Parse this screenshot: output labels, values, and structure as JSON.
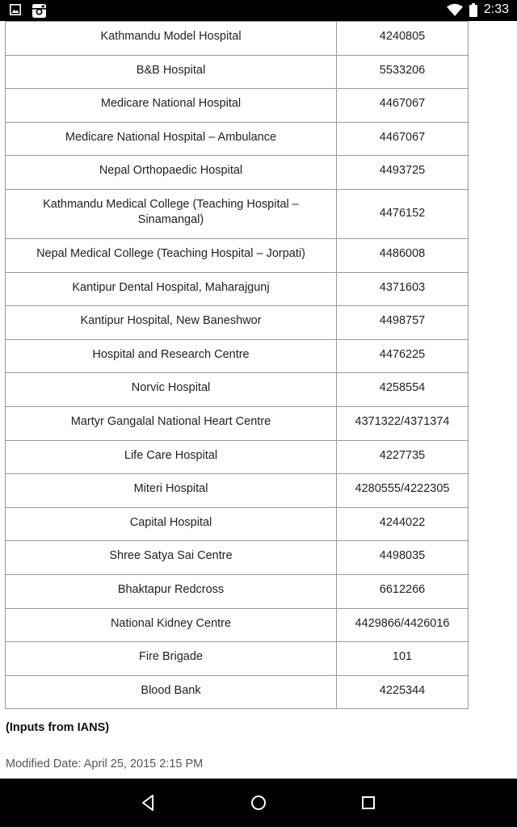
{
  "status_bar": {
    "time": "2:33",
    "left_icons": [
      "image-icon",
      "instagram-icon"
    ],
    "right_icons": [
      "wifi-icon",
      "battery-icon"
    ]
  },
  "table": {
    "rows": [
      {
        "name": "",
        "phone": ""
      },
      {
        "name": "Kathmandu Model Hospital",
        "phone": "4240805"
      },
      {
        "name": "B&B Hospital",
        "phone": "5533206"
      },
      {
        "name": "Medicare National Hospital",
        "phone": "4467067"
      },
      {
        "name": "Medicare National Hospital – Ambulance",
        "phone": "4467067"
      },
      {
        "name": "Nepal Orthopaedic Hospital",
        "phone": "4493725"
      },
      {
        "name": "Kathmandu Medical College (Teaching Hospital – Sinamangal)",
        "phone": "4476152"
      },
      {
        "name": "Nepal Medical College (Teaching Hospital – Jorpati)",
        "phone": "4486008"
      },
      {
        "name": "Kantipur Dental Hospital, Maharajgunj",
        "phone": "4371603"
      },
      {
        "name": "Kantipur Hospital, New Baneshwor",
        "phone": "4498757"
      },
      {
        "name": "Hospital and Research Centre",
        "phone": "4476225"
      },
      {
        "name": "Norvic Hospital",
        "phone": "4258554"
      },
      {
        "name": "Martyr Gangalal National Heart Centre",
        "phone": "4371322/4371374"
      },
      {
        "name": "Life Care Hospital",
        "phone": "4227735"
      },
      {
        "name": "Miteri Hospital",
        "phone": "4280555/4222305"
      },
      {
        "name": "Capital Hospital",
        "phone": "4244022"
      },
      {
        "name": "Shree Satya Sai Centre",
        "phone": "4498035"
      },
      {
        "name": "Bhaktapur Redcross",
        "phone": "6612266"
      },
      {
        "name": "National Kidney Centre",
        "phone": "4429866/4426016"
      },
      {
        "name": "Fire Brigade",
        "phone": "101"
      },
      {
        "name": "Blood Bank",
        "phone": "4225344"
      }
    ]
  },
  "credit": "(Inputs from IANS)",
  "modified_date": "Modified Date: April 25, 2015 2:15 PM",
  "nav_bar": {
    "buttons": [
      "back-icon",
      "home-icon",
      "recents-icon"
    ]
  }
}
